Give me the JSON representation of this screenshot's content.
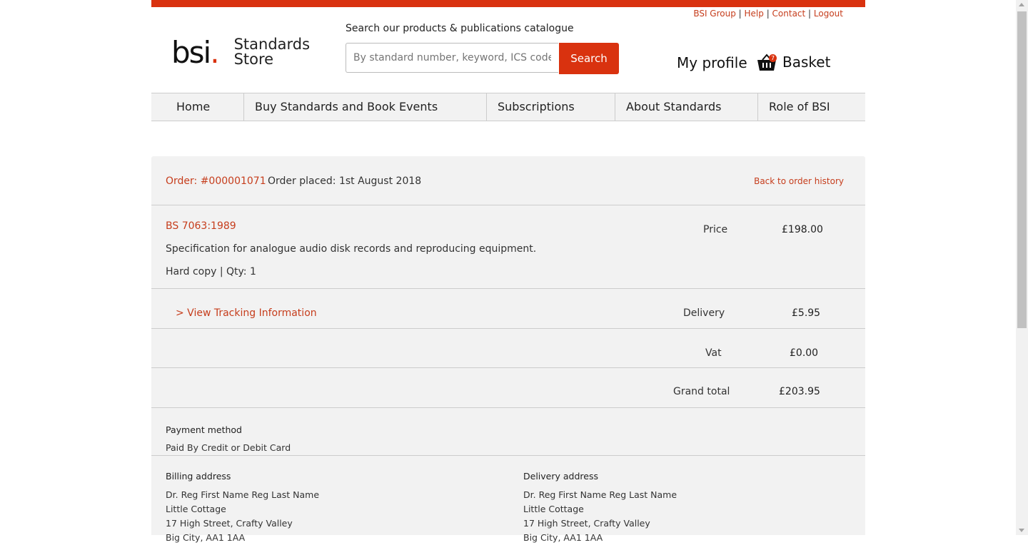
{
  "brand": {
    "colors": {
      "accent": "#d9320f",
      "link": "#c63d1c",
      "panel": "#f2f2f2"
    }
  },
  "toplinks": [
    "BSI Group",
    "Help",
    "Contact",
    "Logout"
  ],
  "logo": {
    "bsi": "bsi",
    "dot": ".",
    "line1": "Standards",
    "line2": "Store"
  },
  "search": {
    "label": "Search our products & publications catalogue",
    "placeholder": "By standard number, keyword, ICS code, ISBN",
    "button": "Search"
  },
  "account": {
    "profile": "My profile",
    "basket": "Basket",
    "basket_count": "7",
    "basket_icon": "basket-icon"
  },
  "nav": [
    "Home",
    "Buy Standards and Book Events",
    "Subscriptions",
    "About Standards",
    "Role of BSI"
  ],
  "order": {
    "number": "Order: #000001071",
    "placed": "Order placed: 1st August 2018",
    "back": "Back to order history",
    "item": {
      "code": "BS 7063:1989",
      "title": "Specification for analogue audio disk records and reproducing equipment.",
      "format": "Hard copy | Qty: 1",
      "price_label": "Price",
      "price": "£198.00"
    },
    "tracking": "> View Tracking Information",
    "delivery_label": "Delivery",
    "delivery": "£5.95",
    "vat_label": "Vat",
    "vat": "£0.00",
    "total_label": "Grand total",
    "total": "£203.95",
    "payment_label": "Payment method",
    "payment": "Paid By Credit or Debit Card",
    "billing": {
      "label": "Billing address",
      "lines": [
        "Dr. Reg First Name Reg Last Name",
        "Little Cottage",
        "17 High Street, Crafty Valley",
        "Big City, AA1 1AA"
      ]
    },
    "delivery_address": {
      "label": "Delivery address",
      "lines": [
        "Dr. Reg First Name Reg Last Name",
        "Little Cottage",
        "17 High Street, Crafty Valley",
        "Big City, AA1 1AA"
      ]
    }
  }
}
